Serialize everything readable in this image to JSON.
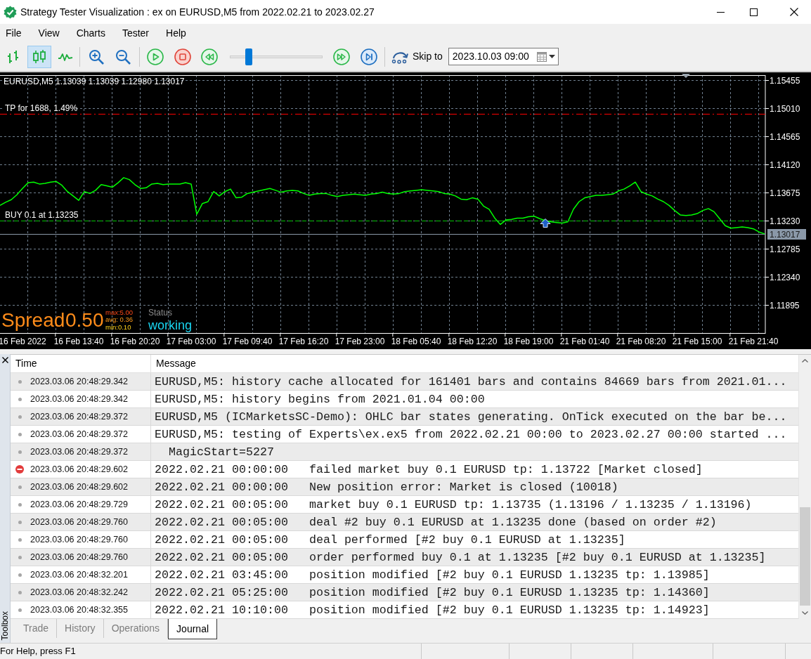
{
  "window": {
    "title": "Strategy Tester Visualization : ex on EURUSD,M5 from 2022.02.21 to 2023.02.27"
  },
  "menu": [
    "File",
    "View",
    "Charts",
    "Tester",
    "Help"
  ],
  "toolbar": {
    "chart_modes": [
      {
        "kind": "bars",
        "selected": false
      },
      {
        "kind": "candles",
        "selected": true
      },
      {
        "kind": "line",
        "selected": false
      }
    ],
    "speed_slider": {
      "level": 0.18
    },
    "skip_label": "Skip to",
    "skip_date": "2023.10.03 09:00"
  },
  "chart": {
    "symbol": "EURUSD,M5",
    "ohlc": "1.13039 1.13039 1.12980 1.13017",
    "overlay": {
      "spread_label": "Spread",
      "spread_value": "0.50",
      "spread_max": "max:5.00",
      "spread_avg": "avg: 0.36",
      "spread_min": "min:0.10",
      "status_label": "Status",
      "status_value": "working"
    },
    "chart_data": {
      "type": "line",
      "grid": true,
      "categories": [
        null,
        null,
        null,
        null,
        "16 Feb 2022",
        null,
        null,
        null,
        null,
        null,
        null,
        null,
        null,
        null,
        "16 Feb 13:40",
        null,
        null,
        null,
        null,
        null,
        null,
        null,
        null,
        null,
        "16 Feb 20:20",
        null,
        null,
        null,
        null,
        null,
        null,
        null,
        null,
        null,
        "17 Feb 03:00",
        null,
        null,
        null,
        null,
        null,
        null,
        null,
        null,
        null,
        "17 Feb 09:40",
        null,
        null,
        null,
        null,
        null,
        null,
        null,
        null,
        null,
        "17 Feb 16:20",
        null,
        null,
        null,
        null,
        null,
        null,
        null,
        null,
        null,
        "17 Feb 23:00",
        null,
        null,
        null,
        null,
        null,
        null,
        null,
        null,
        null,
        "18 Feb 05:40",
        null,
        null,
        null,
        null,
        null,
        null,
        null,
        null,
        null,
        "18 Feb 12:20",
        null,
        null,
        null,
        null,
        null,
        null,
        null,
        null,
        null,
        "18 Feb 19:00",
        null,
        null,
        null,
        null,
        null,
        null,
        null,
        null,
        null,
        "21 Feb 01:40",
        null,
        null,
        null,
        null,
        null,
        null,
        null,
        null,
        null,
        "21 Feb 08:20",
        null,
        null,
        null,
        null,
        null,
        null,
        null,
        null,
        null,
        "21 Feb 15:00",
        null,
        null,
        null,
        null,
        null,
        null,
        null,
        null,
        null,
        "21 Feb 21:40",
        null,
        null
      ],
      "series": [
        {
          "color": "#00ff00",
          "values": [
            1.1347,
            1.1352,
            1.1356,
            1.1364,
            1.1374,
            1.1383,
            1.1384,
            1.1381,
            1.1382,
            1.1384,
            1.1385,
            1.1379,
            1.1369,
            1.1362,
            1.1355,
            1.1369,
            1.1366,
            1.1371,
            1.138,
            1.1378,
            1.1376,
            1.1383,
            1.1391,
            1.1388,
            1.138,
            1.1374,
            1.1375,
            1.1381,
            1.1382,
            1.138,
            1.1381,
            1.1381,
            1.1381,
            1.1383,
            1.1381,
            1.1333,
            1.135,
            1.1353,
            1.1369,
            1.1362,
            1.1369,
            1.1373,
            1.1359,
            1.136,
            1.1366,
            1.1368,
            1.137,
            1.1372,
            1.1374,
            1.1371,
            1.1368,
            1.137,
            1.1371,
            1.137,
            1.1366,
            1.1363,
            1.1365,
            1.1366,
            1.1366,
            1.1363,
            1.1361,
            1.1363,
            1.1364,
            1.1365,
            1.1364,
            1.1363,
            1.1365,
            1.1366,
            1.1368,
            1.1366,
            1.1365,
            1.1366,
            1.1369,
            1.137,
            1.1371,
            1.1372,
            1.1371,
            1.137,
            1.1369,
            1.1366,
            1.1365,
            1.1362,
            1.1357,
            1.1356,
            1.1359,
            1.1357,
            1.1346,
            1.1341,
            1.1327,
            1.1317,
            1.1324,
            1.1325,
            1.1327,
            1.1327,
            1.1329,
            1.133,
            1.1326,
            1.1323,
            1.1321,
            1.132,
            1.1319,
            1.1321,
            1.1341,
            1.1353,
            1.1359,
            1.1361,
            1.1363,
            1.1363,
            1.1364,
            1.1365,
            1.137,
            1.1373,
            1.1378,
            1.1384,
            1.1369,
            1.1365,
            1.1362,
            1.1357,
            1.1353,
            1.1347,
            1.1339,
            1.1332,
            1.1331,
            1.1332,
            1.1334,
            1.1339,
            1.1342,
            1.1337,
            1.1326,
            1.1315,
            1.1311,
            1.1312,
            1.1313,
            1.1312,
            1.131,
            1.1305,
            1.1302
          ]
        },
        {
          "type": "scatter",
          "color": "#1e5fc8",
          "values": [
            null,
            null,
            null,
            null,
            null,
            null,
            null,
            null,
            null,
            null,
            null,
            null,
            null,
            null,
            null,
            null,
            null,
            null,
            null,
            null,
            null,
            null,
            null,
            null,
            null,
            null,
            null,
            null,
            null,
            null,
            null,
            null,
            null,
            null,
            null,
            null,
            null,
            null,
            null,
            null,
            null,
            null,
            null,
            null,
            null,
            null,
            null,
            null,
            null,
            null,
            null,
            null,
            null,
            null,
            null,
            null,
            null,
            null,
            null,
            null,
            null,
            null,
            null,
            null,
            null,
            null,
            null,
            null,
            null,
            null,
            null,
            null,
            null,
            null,
            null,
            null,
            null,
            null,
            null,
            null,
            null,
            null,
            null,
            null,
            null,
            null,
            null,
            null,
            null,
            null,
            null,
            null,
            null,
            null,
            null,
            null,
            null,
            1.1318,
            null,
            null,
            null,
            null,
            null,
            null,
            null,
            null,
            null,
            null,
            null,
            null,
            null,
            null,
            null,
            null,
            null,
            null,
            null,
            null,
            null,
            null,
            null,
            null,
            null,
            null,
            null,
            null,
            null,
            null,
            null,
            null,
            null,
            null,
            null,
            null,
            null,
            null,
            null
          ]
        }
      ],
      "ylim": [
        1.1145,
        1.15533
      ],
      "yticks": [
        {
          "value": 1.15455,
          "label": "1.15455"
        },
        {
          "value": 1.1501,
          "label": "1.15010"
        },
        {
          "value": 1.14565,
          "label": "1.14565"
        },
        {
          "value": 1.1412,
          "label": "1.14120"
        },
        {
          "value": 1.13675,
          "label": "1.13675"
        },
        {
          "value": 1.1323,
          "label": "1.13230"
        },
        {
          "value": 1.12785,
          "label": "1.12785"
        },
        {
          "value": 1.1234,
          "label": "1.12340"
        },
        {
          "value": 1.11895,
          "label": "1.11895"
        }
      ],
      "ref_lines": [
        {
          "axis": "y",
          "value": 1.14923,
          "label": "TP for 1688, 1.49%",
          "color": "#ff0000"
        },
        {
          "axis": "y",
          "value": 1.13235,
          "label": "BUY 0.1 at 1.13235",
          "color": "#00c800"
        },
        {
          "axis": "y",
          "value": 1.13017,
          "label": "1.13017",
          "color": "#8a98a8"
        }
      ]
    }
  },
  "journal": {
    "columns": [
      "Time",
      "Message"
    ],
    "rows": [
      {
        "kind": "info",
        "time": "2023.03.06 20:48:29.342",
        "message": "EURUSD,M5: history cache allocated for 161401 bars and contains 84669 bars from 2021.01..."
      },
      {
        "kind": "info",
        "time": "2023.03.06 20:48:29.342",
        "message": "EURUSD,M5: history begins from 2021.01.04 00:00"
      },
      {
        "kind": "info",
        "time": "2023.03.06 20:48:29.372",
        "message": "EURUSD,M5 (ICMarketsSC-Demo): OHLC bar states generating. OnTick executed on the bar be..."
      },
      {
        "kind": "info",
        "time": "2023.03.06 20:48:29.372",
        "message": "EURUSD,M5: testing of Experts\\ex.ex5 from 2022.02.21 00:00 to 2023.02.27 00:00 started ..."
      },
      {
        "kind": "info",
        "time": "2023.03.06 20:48:29.372",
        "message": "  MagicStart=5227"
      },
      {
        "kind": "error",
        "time": "2023.03.06 20:48:29.602",
        "message": "2022.02.21 00:00:00   failed market buy 0.1 EURUSD tp: 1.13722 [Market closed]"
      },
      {
        "kind": "info",
        "time": "2023.03.06 20:48:29.602",
        "message": "2022.02.21 00:00:00   New position error: Market is closed (10018)"
      },
      {
        "kind": "info",
        "time": "2023.03.06 20:48:29.729",
        "message": "2022.02.21 00:05:00   market buy 0.1 EURUSD tp: 1.13735 (1.13196 / 1.13235 / 1.13196)"
      },
      {
        "kind": "info",
        "time": "2023.03.06 20:48:29.760",
        "message": "2022.02.21 00:05:00   deal #2 buy 0.1 EURUSD at 1.13235 done (based on order #2)"
      },
      {
        "kind": "info",
        "time": "2023.03.06 20:48:29.760",
        "message": "2022.02.21 00:05:00   deal performed [#2 buy 0.1 EURUSD at 1.13235]"
      },
      {
        "kind": "info",
        "time": "2023.03.06 20:48:29.760",
        "message": "2022.02.21 00:05:00   order performed buy 0.1 at 1.13235 [#2 buy 0.1 EURUSD at 1.13235]"
      },
      {
        "kind": "info",
        "time": "2023.03.06 20:48:32.201",
        "message": "2022.02.21 03:45:00   position modified [#2 buy 0.1 EURUSD 1.13235 tp: 1.13985]"
      },
      {
        "kind": "info",
        "time": "2023.03.06 20:48:32.242",
        "message": "2022.02.21 05:25:00   position modified [#2 buy 0.1 EURUSD 1.13235 tp: 1.14360]"
      },
      {
        "kind": "info",
        "time": "2023.03.06 20:48:32.355",
        "message": "2022.02.21 10:10:00   position modified [#2 buy 0.1 EURUSD 1.13235 tp: 1.14923]"
      }
    ]
  },
  "tabs": [
    {
      "label": "Trade",
      "selected": false
    },
    {
      "label": "History",
      "selected": false
    },
    {
      "label": "Operations",
      "selected": false
    },
    {
      "label": "Journal",
      "selected": true
    }
  ],
  "toolbox_label": "Toolbox",
  "status_bar": {
    "text": "For Help, press F1"
  }
}
